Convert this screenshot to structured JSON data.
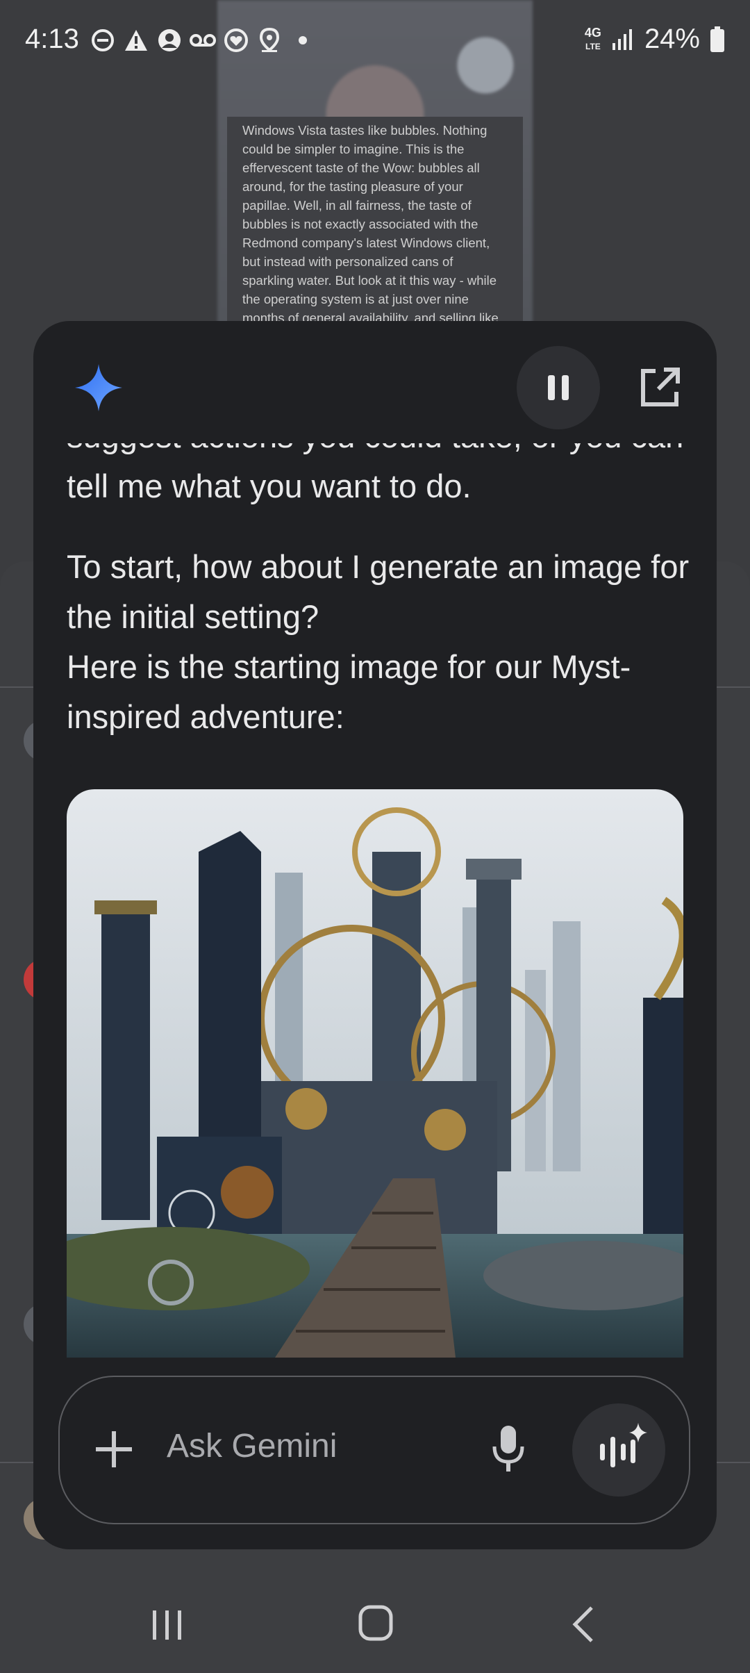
{
  "status_bar": {
    "time": "4:13",
    "network": "4G LTE",
    "battery": "24%",
    "icons": [
      "do-not-disturb-icon",
      "alert-icon",
      "account-icon",
      "voicemail-icon",
      "heart-shield-icon",
      "location-icon",
      "dot-icon"
    ]
  },
  "background_article": {
    "text": "Windows Vista tastes like bubbles. Nothing could be simpler to imagine. This is the effervescent taste of the Wow: bubbles all around, for the tasting pleasure of your papillae. Well, in all fairness, the taste of bubbles is not exactly associated with the Redmond company's latest Windows client, but instead with personalized cans of sparkling water. But look at it this way - while the operating system is at just over nine months of general availability, and selling like hot cakes"
  },
  "gemini": {
    "cut_line": "suggest actions you could take, or you can just",
    "messages": [
      "tell me what you want to do.",
      "To start, how about I generate an image for the initial setting?",
      "Here is the starting image for our Myst-inspired adventure:"
    ],
    "input_placeholder": "Ask Gemini",
    "accent_color": "#4f8cf7"
  },
  "nav": {
    "icons": [
      "recent-apps-icon",
      "home-icon",
      "back-icon"
    ]
  }
}
